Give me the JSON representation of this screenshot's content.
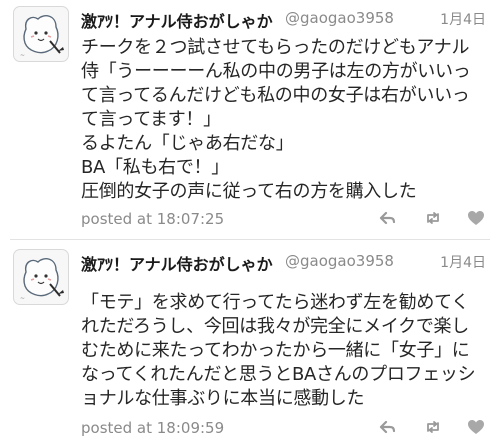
{
  "tweets": [
    {
      "name": "激ｱﾂ！アナル侍おがしゃか",
      "handle": "@gaogao3958",
      "date": "1月4日",
      "lines": [
        "チークを２つ試させてもらったのだけどもアナル",
        "侍「うーーーーん私の中の男子は左の方がいいっ",
        "て言ってるんだけども私の中の女子は右がいいっ",
        "て言ってます！」",
        "るよたん「じゃあ右だな」",
        "BA「私も右で！」",
        "圧倒的女子の声に従って右の方を購入した"
      ],
      "posted": "posted at 18:07:25"
    },
    {
      "name": "激ｱﾂ！アナル侍おがしゃか",
      "handle": "@gaogao3958",
      "date": "1月4日",
      "lines": [
        "「モテ」を求めて行ってたら迷わず左を勧めてく",
        "れただろうし、今回は我々が完全にメイクで楽し",
        "むために来たってわかったから一緒に「女子」に",
        "なってくれたんだと思うとBAさんのプロフェッシ",
        "ョナルな仕事ぶりに本当に感動した"
      ],
      "posted": "posted at 18:09:59"
    }
  ],
  "icons": [
    "avatar-illustration",
    "reply-icon",
    "retweet-icon",
    "favorite-icon"
  ],
  "colors": {
    "muted": "#8a8a8a",
    "icon": "#9a9a9a",
    "divider": "#e3e3e3",
    "text": "#262626"
  }
}
